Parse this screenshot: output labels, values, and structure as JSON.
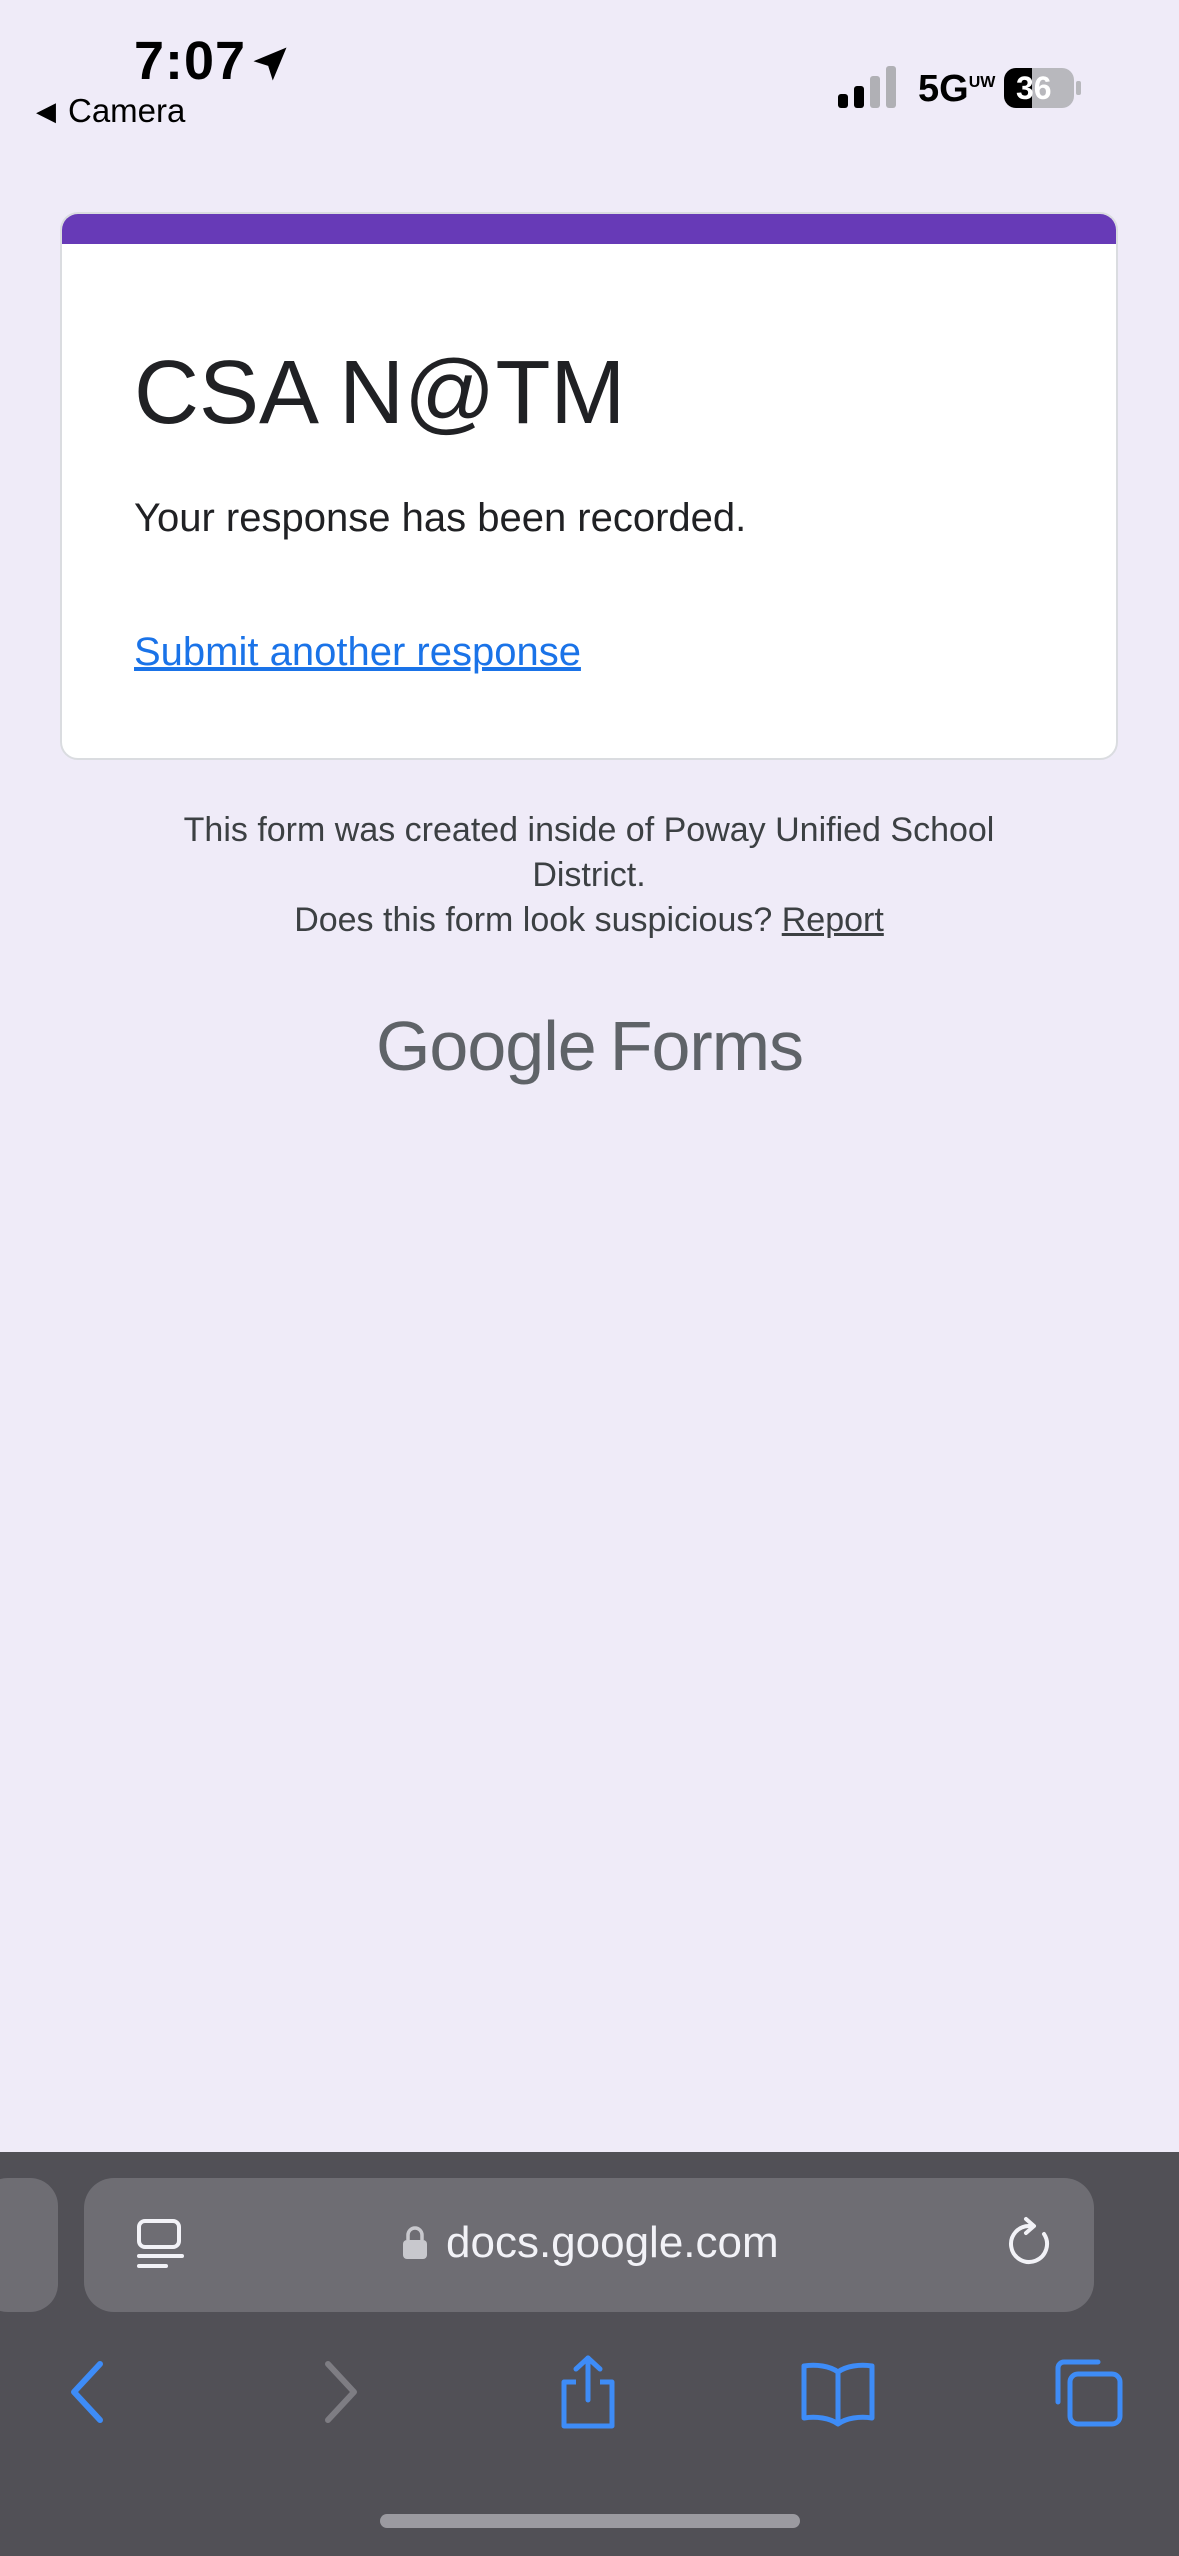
{
  "status_bar": {
    "time": "7:07",
    "back_app": "Camera",
    "network": "5G",
    "network_suffix": "UW",
    "battery": "36"
  },
  "form": {
    "accent_color": "#673ab7",
    "title": "CSA N@TM",
    "confirmation": "Your response has been recorded.",
    "submit_another": "Submit another response"
  },
  "footer": {
    "line1": "This form was created inside of Poway Unified School District.",
    "line2": "Does this form look suspicious?",
    "report": "Report"
  },
  "branding": {
    "google": "Google",
    "forms": "Forms"
  },
  "browser": {
    "url": "docs.google.com",
    "icons": [
      "reader-icon",
      "lock-icon",
      "reload-icon",
      "back-icon",
      "forward-icon",
      "share-icon",
      "bookmarks-icon",
      "tabs-icon"
    ]
  }
}
